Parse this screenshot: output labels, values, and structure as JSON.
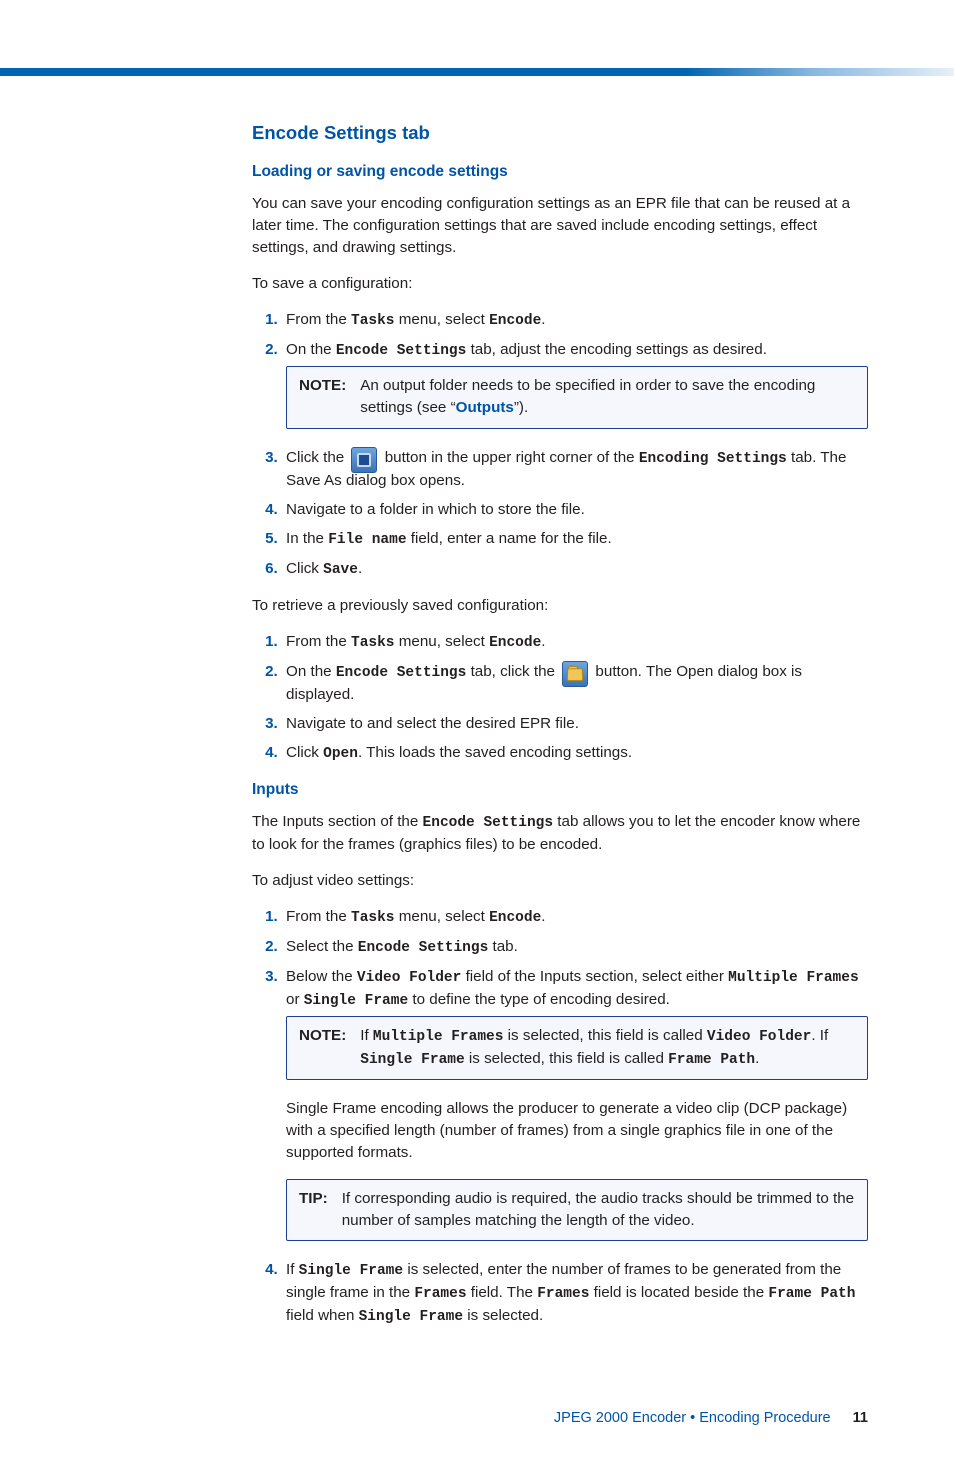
{
  "heading_main": "Encode Settings tab",
  "section1": {
    "heading": "Loading or saving encode settings",
    "intro": "You can save your encoding configuration settings as an EPR file that can be reused at a later time. The configuration settings that are saved include encoding settings, effect settings, and drawing settings.",
    "lead_save": "To save a configuration:",
    "step1_a": "From the ",
    "step1_mono1": "Tasks",
    "step1_b": " menu, select ",
    "step1_mono2": "Encode",
    "step1_c": ".",
    "step2_a": "On the ",
    "step2_mono": "Encode Settings",
    "step2_b": " tab, adjust the encoding settings as desired.",
    "note1_label": "NOTE:",
    "note1_a": "An output folder needs to be specified in order to save the encoding settings (see “",
    "note1_link": "Outputs",
    "note1_b": "”).",
    "step3_a": "Click the ",
    "step3_b": " button in the upper right corner of the ",
    "step3_mono": "Encoding Settings",
    "step3_c": " tab. The Save As dialog box opens.",
    "step4": "Navigate to a folder in which to store the file.",
    "step5_a": "In the ",
    "step5_mono": "File name",
    "step5_b": " field, enter a name for the file.",
    "step6_a": "Click ",
    "step6_mono": "Save",
    "step6_b": ".",
    "lead_retrieve": "To retrieve a previously saved configuration:",
    "r1_a": "From the ",
    "r1_mono1": "Tasks",
    "r1_b": " menu, select ",
    "r1_mono2": "Encode",
    "r1_c": ".",
    "r2_a": "On the ",
    "r2_mono": "Encode Settings",
    "r2_b": " tab, click the ",
    "r2_c": " button. The Open dialog box is displayed.",
    "r3": "Navigate to and select the desired EPR file.",
    "r4_a": "Click ",
    "r4_mono": "Open",
    "r4_b": ". This loads the saved encoding settings."
  },
  "section2": {
    "heading": "Inputs",
    "intro_a": "The Inputs section of the ",
    "intro_mono": "Encode Settings",
    "intro_b": " tab allows you to let the encoder know where to look for the frames (graphics files) to be encoded.",
    "lead": "To adjust video settings:",
    "s1_a": "From the ",
    "s1_mono1": "Tasks",
    "s1_b": " menu, select ",
    "s1_mono2": "Encode",
    "s1_c": ".",
    "s2_a": "Select the ",
    "s2_mono": "Encode Settings",
    "s2_b": " tab.",
    "s3_a": "Below the ",
    "s3_mono1": "Video Folder",
    "s3_b": " field of the Inputs section, select either ",
    "s3_mono2": "Multiple Frames",
    "s3_c": " or ",
    "s3_mono3": "Single Frame",
    "s3_d": " to define the type of encoding desired.",
    "note2_label": "NOTE:",
    "note2_a": "If ",
    "note2_mono1": "Multiple Frames",
    "note2_b": " is selected, this field is called ",
    "note2_mono2": "Video Folder",
    "note2_c": ". If ",
    "note2_mono3": "Single Frame",
    "note2_d": " is selected, this field is called ",
    "note2_mono4": "Frame Path",
    "note2_e": ".",
    "para": "Single Frame encoding allows the producer to generate a video clip (DCP package) with a specified length (number of frames) from a single graphics file in one of the supported formats.",
    "tip_label": "TIP:",
    "tip_body": "If corresponding audio is required, the audio tracks should be trimmed to the number of samples matching the length of the video.",
    "s4_a": "If ",
    "s4_mono1": "Single Frame",
    "s4_b": " is selected, enter the number of frames to be generated from the single frame in the ",
    "s4_mono2": "Frames",
    "s4_c": " field. The ",
    "s4_mono3": "Frames",
    "s4_d": " field is located beside the ",
    "s4_mono4": "Frame Path",
    "s4_e": " field when ",
    "s4_mono5": "Single Frame",
    "s4_f": " is selected."
  },
  "footer": {
    "text": "JPEG 2000 Encoder • Encoding Procedure",
    "page": "11"
  }
}
